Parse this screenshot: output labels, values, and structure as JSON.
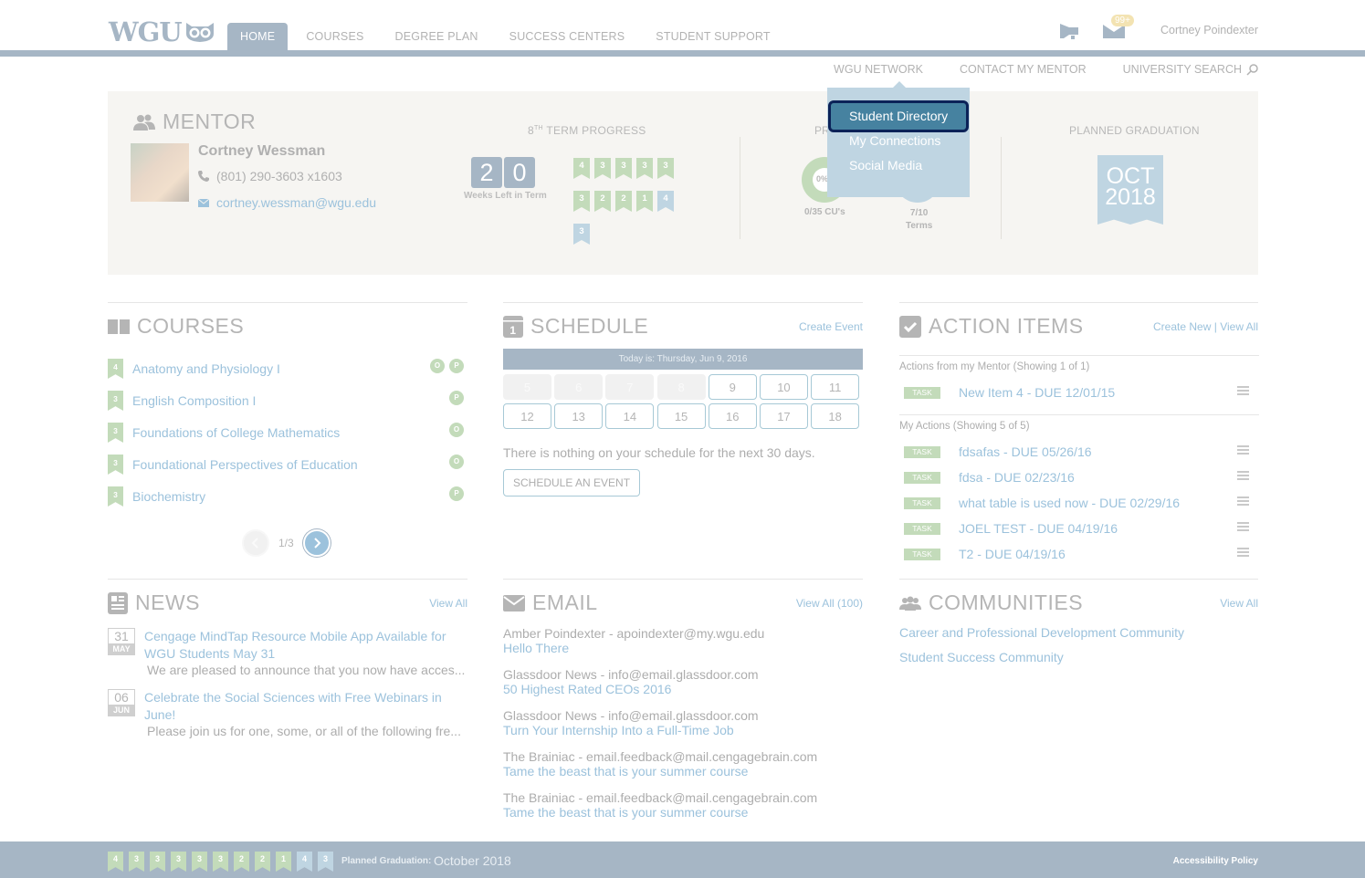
{
  "header": {
    "logo_text": "WGU",
    "nav": [
      {
        "label": "HOME",
        "active": true
      },
      {
        "label": "COURSES",
        "active": false
      },
      {
        "label": "DEGREE PLAN",
        "active": false
      },
      {
        "label": "SUCCESS CENTERS",
        "active": false
      },
      {
        "label": "STUDENT SUPPORT",
        "active": false
      }
    ],
    "notification_badge": "99+",
    "user_name": "Cortney Poindexter",
    "subnav": [
      "WGU NETWORK",
      "CONTACT MY MENTOR",
      "UNIVERSITY SEARCH"
    ],
    "colors": {
      "brand": "#a6b6c5",
      "link": "#9cc2dc",
      "green": "#c3dbba",
      "blue": "#bfd5e2"
    }
  },
  "network_dropdown": {
    "items": [
      "Student Directory",
      "My Connections",
      "Social Media"
    ],
    "focused_item": "Student Directory"
  },
  "mentor": {
    "title": "MENTOR",
    "name": "Cortney Wessman",
    "phone": "(801) 290-3603 x1603",
    "email": "cortney.wessman@wgu.edu"
  },
  "term_progress": {
    "title_ordinal": "8",
    "title_suffix": "TH",
    "title": "TERM PROGRESS",
    "weeks_digits": [
      "2",
      "0"
    ],
    "weeks_label": "Weeks Left in Term",
    "course_units": [
      {
        "cu": "4",
        "status": "complete"
      },
      {
        "cu": "3",
        "status": "complete"
      },
      {
        "cu": "3",
        "status": "complete"
      },
      {
        "cu": "3",
        "status": "complete"
      },
      {
        "cu": "3",
        "status": "complete"
      },
      {
        "cu": "3",
        "status": "complete"
      },
      {
        "cu": "2",
        "status": "complete"
      },
      {
        "cu": "2",
        "status": "complete"
      },
      {
        "cu": "1",
        "status": "complete"
      },
      {
        "cu": "4",
        "status": "current"
      },
      {
        "cu": "3",
        "status": "current"
      }
    ]
  },
  "program_progress": {
    "title_fragment": "PR",
    "percent_label": "0%",
    "cu_label": "0/35 CU's",
    "terms_value": "7/10",
    "terms_label": "Terms"
  },
  "planned_graduation": {
    "title": "PLANNED GRADUATION",
    "month": "OCT",
    "year": "2018"
  },
  "courses": {
    "title": "COURSES",
    "items": [
      {
        "cu": "4",
        "name": "Anatomy and Physiology I",
        "tags": [
          "O",
          "P"
        ]
      },
      {
        "cu": "3",
        "name": "English Composition I",
        "tags": [
          "P"
        ]
      },
      {
        "cu": "3",
        "name": "Foundations of College Mathematics",
        "tags": [
          "O"
        ]
      },
      {
        "cu": "3",
        "name": "Foundational Perspectives of Education",
        "tags": [
          "O"
        ]
      },
      {
        "cu": "3",
        "name": "Biochemistry",
        "tags": [
          "P"
        ]
      }
    ],
    "page": "1/3"
  },
  "schedule": {
    "title": "SCHEDULE",
    "create_link": "Create Event",
    "today_label": "Today is: Thursday, Jun 9, 2016",
    "days": [
      {
        "d": "5",
        "past": true
      },
      {
        "d": "6",
        "past": true
      },
      {
        "d": "7",
        "past": true
      },
      {
        "d": "8",
        "past": true
      },
      {
        "d": "9",
        "past": false
      },
      {
        "d": "10",
        "past": false
      },
      {
        "d": "11",
        "past": false
      },
      {
        "d": "12",
        "past": false
      },
      {
        "d": "13",
        "past": false
      },
      {
        "d": "14",
        "past": false
      },
      {
        "d": "15",
        "past": false
      },
      {
        "d": "16",
        "past": false
      },
      {
        "d": "17",
        "past": false
      },
      {
        "d": "18",
        "past": false
      }
    ],
    "empty_message": "There is nothing on your schedule for the next 30 days.",
    "button_label": "SCHEDULE AN EVENT"
  },
  "action_items": {
    "title": "ACTION ITEMS",
    "create_link": "Create New",
    "separator": "|",
    "view_link": "View All",
    "mentor_heading": "Actions from my Mentor (Showing 1 of 1)",
    "mentor_items": [
      {
        "tag": "TASK",
        "text": "New Item 4 - DUE 12/01/15"
      }
    ],
    "my_heading": "My Actions (Showing 5 of 5)",
    "my_items": [
      {
        "tag": "TASK",
        "text": "fdsafas - DUE 05/26/16"
      },
      {
        "tag": "TASK",
        "text": "fdsa - DUE 02/23/16"
      },
      {
        "tag": "TASK",
        "text": "what table is used now - DUE 02/29/16"
      },
      {
        "tag": "TASK",
        "text": "JOEL TEST - DUE 04/19/16"
      },
      {
        "tag": "TASK",
        "text": "T2 - DUE 04/19/16"
      }
    ]
  },
  "news": {
    "title": "NEWS",
    "view_link": "View All",
    "items": [
      {
        "day": "31",
        "month": "MAY",
        "title": "Cengage MindTap Resource Mobile App Available for WGU Students May 31",
        "snippet": "We are pleased to announce that you now have acces..."
      },
      {
        "day": "06",
        "month": "JUN",
        "title": "Celebrate the Social Sciences with Free Webinars in June!",
        "snippet": "Please join us for one, some, or all of the following fre..."
      }
    ]
  },
  "email": {
    "title": "EMAIL",
    "view_link": "View All (100)",
    "items": [
      {
        "from": "Amber Poindexter - apoindexter@my.wgu.edu",
        "subject": "Hello There"
      },
      {
        "from": "Glassdoor News - info@email.glassdoor.com",
        "subject": "50 Highest Rated CEOs 2016"
      },
      {
        "from": "Glassdoor News - info@email.glassdoor.com",
        "subject": "Turn Your Internship Into a Full-Time Job"
      },
      {
        "from": "The Brainiac - email.feedback@mail.cengagebrain.com",
        "subject": "Tame the beast that is your summer course"
      },
      {
        "from": "The Brainiac - email.feedback@mail.cengagebrain.com",
        "subject": "Tame the beast that is your summer course"
      }
    ]
  },
  "communities": {
    "title": "COMMUNITIES",
    "view_link": "View All",
    "items": [
      "Career and Professional Development Community",
      "Student Success Community"
    ]
  },
  "footer": {
    "planned_graduation_label": "Planned Graduation:",
    "planned_graduation_value": "October 2018",
    "accessibility_link": "Accessibility Policy"
  }
}
